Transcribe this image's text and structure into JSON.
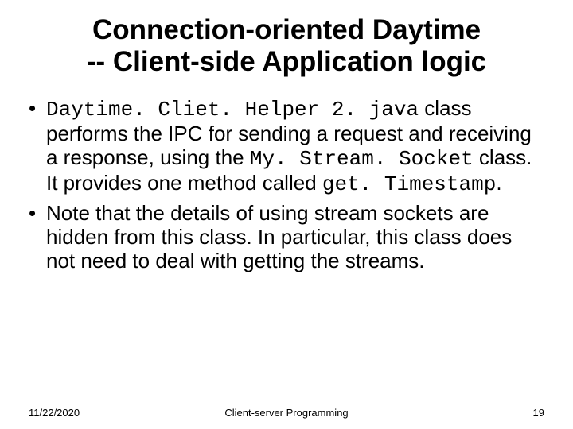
{
  "title_line1": "Connection-oriented Daytime",
  "title_line2": "-- Client-side Application logic",
  "bullet1": {
    "code1": "Daytime. Cliet. Helper 2. java",
    "text1": " class performs the IPC for sending a request and receiving a response, using the ",
    "code2": "My. Stream. Socket",
    "text2": "  class. It provides one method called ",
    "code3": "get. Timestamp",
    "text3": "."
  },
  "bullet2": "Note that the details of using stream sockets are hidden from this class.  In particular, this class does not need to deal with getting the streams.",
  "footer": {
    "date": "11/22/2020",
    "title": "Client-server Programming",
    "page": "19"
  }
}
